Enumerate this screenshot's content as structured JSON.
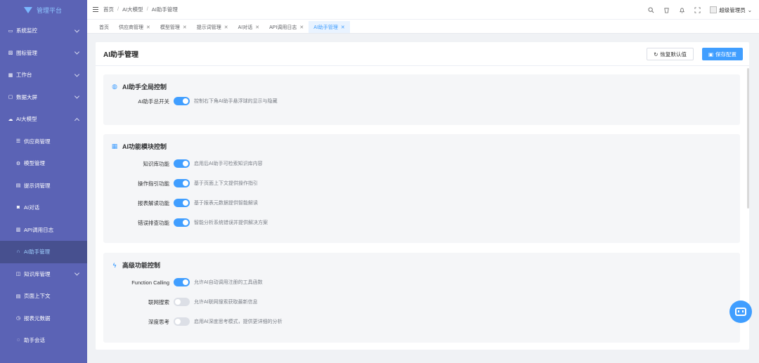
{
  "app": {
    "name": "管理平台"
  },
  "sidebar": {
    "items": [
      {
        "label": "系统监控",
        "icon": "monitor-icon",
        "expand": "down",
        "sub": false,
        "active": false
      },
      {
        "label": "图标管理",
        "icon": "picture-icon",
        "expand": "down",
        "sub": false,
        "active": false
      },
      {
        "label": "工作台",
        "icon": "grid-icon",
        "expand": "down",
        "sub": false,
        "active": false
      },
      {
        "label": "数据大屏",
        "icon": "screen-icon",
        "expand": "down",
        "sub": false,
        "active": false
      },
      {
        "label": "AI大模型",
        "icon": "cloud-icon",
        "expand": "up",
        "sub": false,
        "active": false
      },
      {
        "label": "供应商管理",
        "icon": "list-icon",
        "expand": "",
        "sub": true,
        "active": false
      },
      {
        "label": "模型管理",
        "icon": "settings-icon",
        "expand": "",
        "sub": true,
        "active": false
      },
      {
        "label": "提示词管理",
        "icon": "message-icon",
        "expand": "",
        "sub": true,
        "active": false
      },
      {
        "label": "AI对话",
        "icon": "chat-icon",
        "expand": "",
        "sub": true,
        "active": false
      },
      {
        "label": "API调用日志",
        "icon": "log-icon",
        "expand": "",
        "sub": true,
        "active": false
      },
      {
        "label": "AI助手管理",
        "icon": "headset-icon",
        "expand": "",
        "sub": true,
        "active": true
      },
      {
        "label": "知识库管理",
        "icon": "book-icon",
        "expand": "down",
        "sub": true,
        "active": false
      },
      {
        "label": "页面上下文",
        "icon": "page-icon",
        "expand": "",
        "sub": true,
        "active": false
      },
      {
        "label": "报表元数据",
        "icon": "report-icon",
        "expand": "",
        "sub": true,
        "active": false
      },
      {
        "label": "助手会话",
        "icon": "conversation-icon",
        "expand": "",
        "sub": true,
        "active": false
      }
    ]
  },
  "header": {
    "breadcrumb": [
      "首页",
      "AI大模型",
      "AI助手管理"
    ],
    "user": "超级管理员"
  },
  "tabs": [
    {
      "label": "首页",
      "closable": false,
      "active": false
    },
    {
      "label": "供应商管理",
      "closable": true,
      "active": false
    },
    {
      "label": "模型管理",
      "closable": true,
      "active": false
    },
    {
      "label": "提示词管理",
      "closable": true,
      "active": false
    },
    {
      "label": "AI对话",
      "closable": true,
      "active": false
    },
    {
      "label": "API调用日志",
      "closable": true,
      "active": false
    },
    {
      "label": "AI助手管理",
      "closable": true,
      "active": true
    }
  ],
  "page": {
    "title": "AI助手管理",
    "reset_label": "恢复默认值",
    "save_label": "保存配置"
  },
  "sections": [
    {
      "title": "AI助手全局控制",
      "icon": "globe-icon",
      "rows": [
        {
          "label": "AI助手总开关",
          "on": true,
          "desc": "控制右下角AI助手悬浮球的显示与隐藏"
        }
      ]
    },
    {
      "title": "AI功能模块控制",
      "icon": "modules-icon",
      "rows": [
        {
          "label": "知识库功能",
          "on": true,
          "desc": "启用后AI助手可检索知识库内容"
        },
        {
          "label": "操作指引功能",
          "on": true,
          "desc": "基于页面上下文提供操作指引"
        },
        {
          "label": "报表解读功能",
          "on": true,
          "desc": "基于报表元数据提供智能解读"
        },
        {
          "label": "错误排查功能",
          "on": true,
          "desc": "智能分析系统错误并提供解决方案"
        }
      ]
    },
    {
      "title": "高级功能控制",
      "icon": "lightning-icon",
      "rows": [
        {
          "label": "Function Calling",
          "on": true,
          "desc": "允许AI自动调用注册的工具函数"
        },
        {
          "label": "联网搜索",
          "on": false,
          "desc": "允许AI联网搜索获取最新信息"
        },
        {
          "label": "深度思考",
          "on": false,
          "desc": "启用AI深度思考模式，提供更详细的分析"
        }
      ]
    }
  ]
}
